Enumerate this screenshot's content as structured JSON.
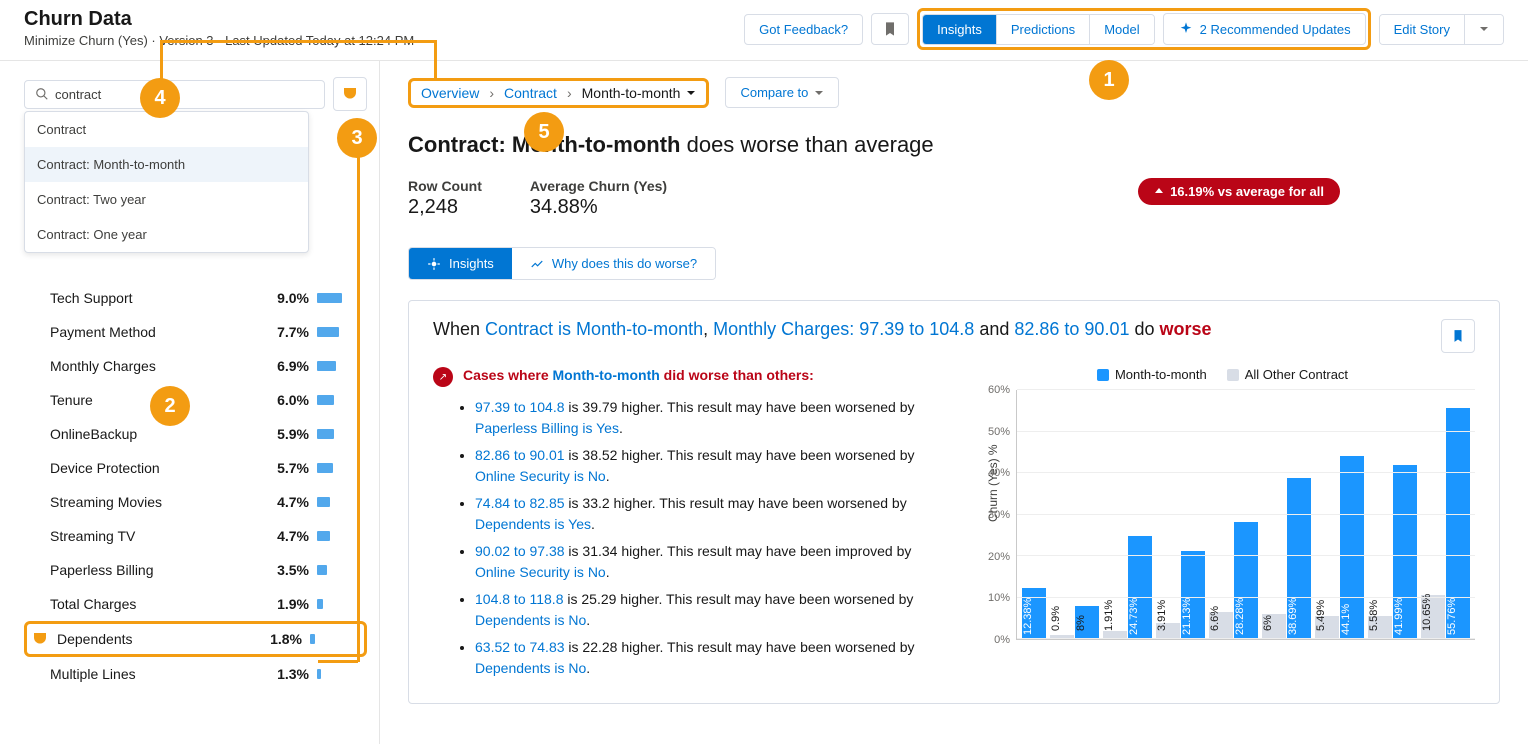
{
  "header": {
    "title": "Churn Data",
    "subtitle": "Minimize Churn (Yes) · Version 3 · Last Updated Today at 12:24 PM",
    "feedback": "Got Feedback?",
    "tabs": {
      "insights": "Insights",
      "predictions": "Predictions",
      "model": "Model"
    },
    "recommended": "2 Recommended Updates",
    "edit": "Edit Story"
  },
  "search": {
    "value": "contract",
    "suggestions": [
      "Contract",
      "Contract: Month-to-month",
      "Contract: Two year",
      "Contract: One year"
    ]
  },
  "metrics": [
    {
      "name": "Tech Support",
      "value": "9.0%",
      "bar": 50
    },
    {
      "name": "Payment Method",
      "value": "7.7%",
      "bar": 43
    },
    {
      "name": "Monthly Charges",
      "value": "6.9%",
      "bar": 38
    },
    {
      "name": "Tenure",
      "value": "6.0%",
      "bar": 33
    },
    {
      "name": "OnlineBackup",
      "value": "5.9%",
      "bar": 33
    },
    {
      "name": "Device Protection",
      "value": "5.7%",
      "bar": 32
    },
    {
      "name": "Streaming Movies",
      "value": "4.7%",
      "bar": 26
    },
    {
      "name": "Streaming TV",
      "value": "4.7%",
      "bar": 26
    },
    {
      "name": "Paperless Billing",
      "value": "3.5%",
      "bar": 19
    },
    {
      "name": "Total Charges",
      "value": "1.9%",
      "bar": 11
    },
    {
      "name": "Dependents",
      "value": "1.8%",
      "bar": 10,
      "highlight": true,
      "badge": true
    },
    {
      "name": "Multiple Lines",
      "value": "1.3%",
      "bar": 7
    }
  ],
  "breadcrumb": {
    "overview": "Overview",
    "contract": "Contract",
    "current": "Month-to-month",
    "compare": "Compare to"
  },
  "page_title": {
    "prefix": "Contract: Month-to-month",
    "suffix": " does worse than average"
  },
  "stats": {
    "rowcount_lbl": "Row Count",
    "rowcount_val": "2,248",
    "avg_lbl": "Average Churn (Yes)",
    "avg_val": "34.88%",
    "pill": "16.19% vs average for all"
  },
  "tabs": {
    "insights": "Insights",
    "why": "Why does this do worse?"
  },
  "card": {
    "title_parts": {
      "p1": "When ",
      "l1": "Contract is Month-to-month",
      "p2": ", ",
      "l2": "Monthly Charges: 97.39 to 104.8",
      "p3": " and ",
      "l3": "82.86 to 90.01",
      "p4": " do ",
      "worse": "worse"
    },
    "cases_head_pre": "Cases where ",
    "cases_head_link": "Month-to-month",
    "cases_head_post": " did worse than others:",
    "cases": [
      {
        "l1": "97.39 to 104.8",
        "t1": " is 39.79 higher. This result may have been worsened by ",
        "l2": "Paperless Billing is Yes",
        "t2": "."
      },
      {
        "l1": "82.86 to 90.01",
        "t1": " is 38.52 higher. This result may have been worsened by ",
        "l2": "Online Security is No",
        "t2": "."
      },
      {
        "l1": "74.84 to 82.85",
        "t1": " is 33.2 higher. This result may have been worsened by ",
        "l2": "Dependents is Yes",
        "t2": "."
      },
      {
        "l1": "90.02 to 97.38",
        "t1": " is 31.34 higher. This result may have been improved by ",
        "l2": "Online Security is No",
        "t2": "."
      },
      {
        "l1": "104.8 to 118.8",
        "t1": " is 25.29 higher. This result may have been worsened by ",
        "l2": "Dependents is No",
        "t2": "."
      },
      {
        "l1": "63.52 to 74.83",
        "t1": " is 22.28 higher. This result may have been worsened by ",
        "l2": "Dependents is No",
        "t2": "."
      }
    ]
  },
  "chart_data": {
    "type": "bar",
    "legend": {
      "a": "Month-to-month",
      "b": "All Other Contract"
    },
    "ylabel": "Churn (Yes) %",
    "ylim": [
      0,
      60
    ],
    "yticks": [
      "0%",
      "10%",
      "20%",
      "30%",
      "40%",
      "50%",
      "60%"
    ],
    "series": [
      {
        "name": "Month-to-month",
        "values": [
          12.38,
          8,
          24.73,
          21.13,
          28.28,
          38.69,
          44.1,
          41.99,
          55.76
        ]
      },
      {
        "name": "All Other Contract",
        "values": [
          0.9,
          1.91,
          3.91,
          6.6,
          6,
          5.49,
          5.58,
          10.65,
          null
        ]
      }
    ],
    "labels": [
      [
        "12.38%",
        "0.9%"
      ],
      [
        "8%",
        "1.91%"
      ],
      [
        "24.73%",
        "3.91%"
      ],
      [
        "21.13%",
        "6.6%"
      ],
      [
        "28.28%",
        "6%"
      ],
      [
        "38.69%",
        "5.49%"
      ],
      [
        "44.1%",
        "5.58%"
      ],
      [
        "41.99%",
        "10.65%"
      ],
      [
        "55.76%",
        ""
      ]
    ]
  },
  "callouts": {
    "1": "1",
    "2": "2",
    "3": "3",
    "4": "4",
    "5": "5"
  }
}
